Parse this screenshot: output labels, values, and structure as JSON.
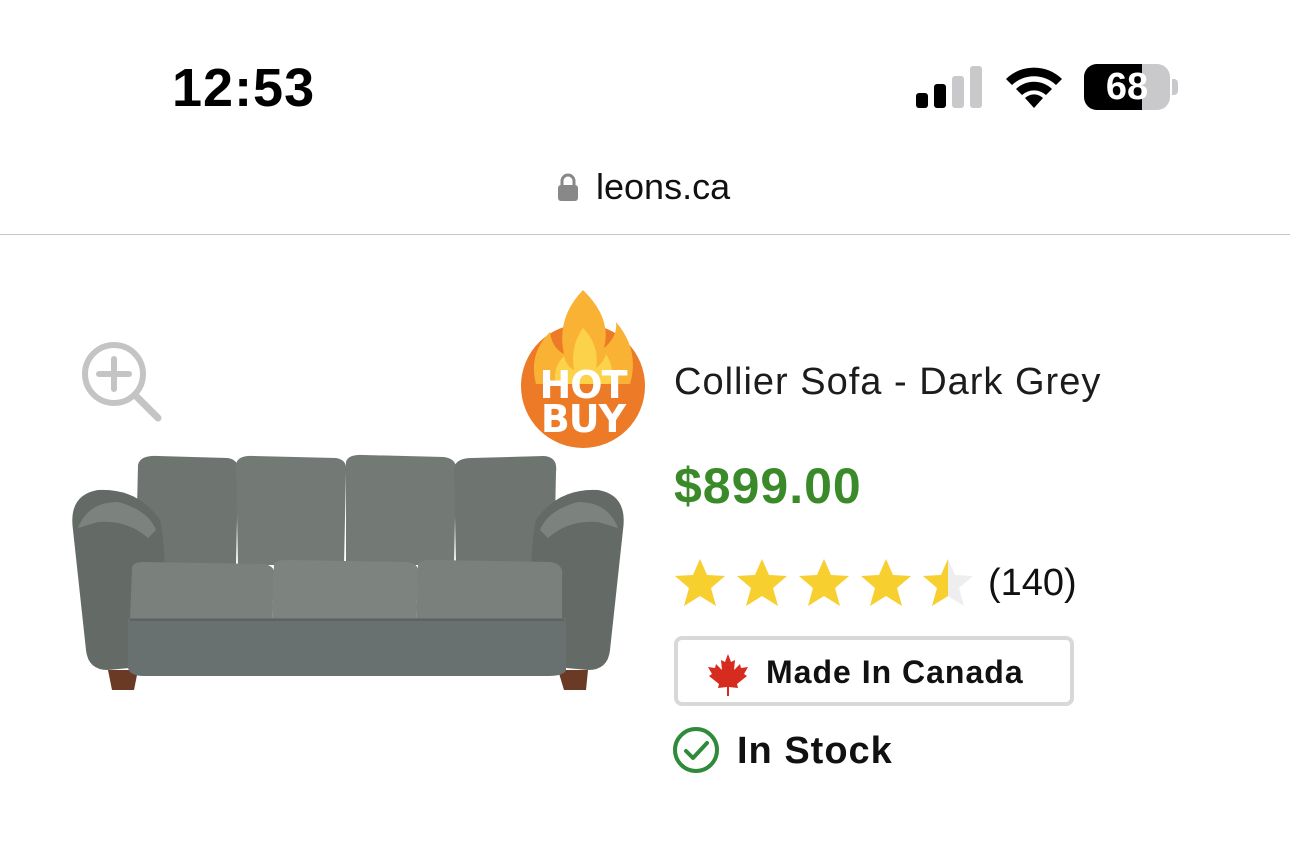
{
  "status_bar": {
    "time": "12:53",
    "battery_percent": "68",
    "battery_level": 0.68,
    "signal_bars_active": 2,
    "signal_bars_total": 4
  },
  "browser": {
    "url": "leons.ca"
  },
  "product": {
    "badge_line1": "HOT",
    "badge_line2": "BUY",
    "title": "Collier Sofa - Dark Grey",
    "price": "$899.00",
    "rating": 4.5,
    "rating_max": 5,
    "review_count": "(140)",
    "origin_badge": "Made In Canada",
    "stock_status": "In Stock"
  },
  "colors": {
    "price_green": "#3a8a2a",
    "star_yellow": "#f7cf2f",
    "hot_orange": "#ec7a26",
    "maple_red": "#d62b1f",
    "stock_green": "#2f8a3a"
  },
  "icons": {
    "lock": "lock-icon",
    "zoom": "zoom-in-icon",
    "check": "check-circle-icon",
    "maple": "maple-leaf-icon"
  }
}
